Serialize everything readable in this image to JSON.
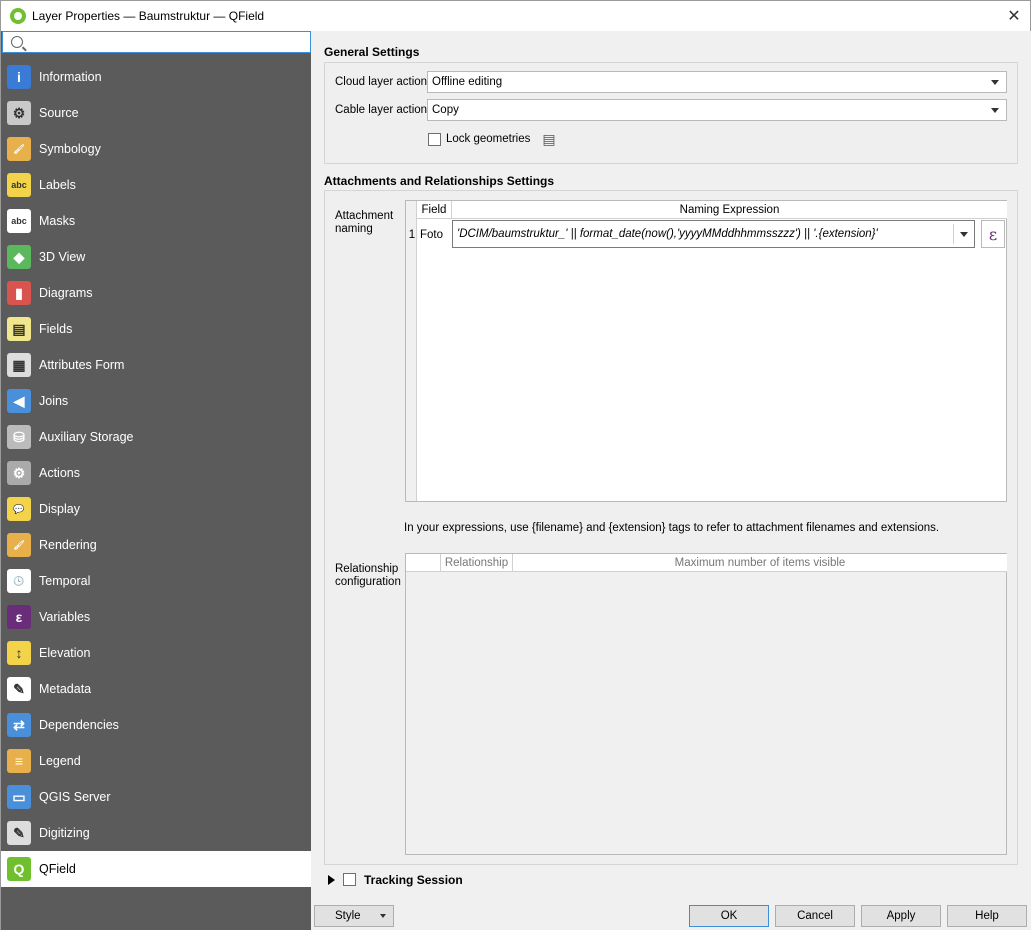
{
  "window": {
    "title": "Layer Properties — Baumstruktur — QField",
    "close_glyph": "✕"
  },
  "search": {
    "value": "",
    "placeholder": ""
  },
  "nav_items": [
    {
      "label": "Information",
      "icon": "info-icon",
      "color": "#3a7bd5",
      "glyph": "i"
    },
    {
      "label": "Source",
      "icon": "source-icon",
      "color": "#c9c9c9",
      "glyph": "⚙"
    },
    {
      "label": "Symbology",
      "icon": "symbology-icon",
      "color": "#e8b04a",
      "glyph": "🖌"
    },
    {
      "label": "Labels",
      "icon": "labels-icon",
      "color": "#f2d34a",
      "glyph": "abc"
    },
    {
      "label": "Masks",
      "icon": "masks-icon",
      "color": "#ffffff",
      "glyph": "abc"
    },
    {
      "label": "3D View",
      "icon": "3d-view-icon",
      "color": "#5cb85c",
      "glyph": "◆"
    },
    {
      "label": "Diagrams",
      "icon": "diagrams-icon",
      "color": "#d9534f",
      "glyph": "▮"
    },
    {
      "label": "Fields",
      "icon": "fields-icon",
      "color": "#f0e68c",
      "glyph": "▤"
    },
    {
      "label": "Attributes Form",
      "icon": "attributes-form-icon",
      "color": "#dddddd",
      "glyph": "▦"
    },
    {
      "label": "Joins",
      "icon": "joins-icon",
      "color": "#4a8fd9",
      "glyph": "◀"
    },
    {
      "label": "Auxiliary Storage",
      "icon": "auxiliary-storage-icon",
      "color": "#bbbbbb",
      "glyph": "⛁"
    },
    {
      "label": "Actions",
      "icon": "actions-icon",
      "color": "#aaaaaa",
      "glyph": "⚙"
    },
    {
      "label": "Display",
      "icon": "display-icon",
      "color": "#f2d34a",
      "glyph": "💬"
    },
    {
      "label": "Rendering",
      "icon": "rendering-icon",
      "color": "#e8b04a",
      "glyph": "🖌"
    },
    {
      "label": "Temporal",
      "icon": "temporal-icon",
      "color": "#ffffff",
      "glyph": "🕓"
    },
    {
      "label": "Variables",
      "icon": "variables-icon",
      "color": "#6a2d7a",
      "glyph": "ε"
    },
    {
      "label": "Elevation",
      "icon": "elevation-icon",
      "color": "#f2d34a",
      "glyph": "↕"
    },
    {
      "label": "Metadata",
      "icon": "metadata-icon",
      "color": "#ffffff",
      "glyph": "✎"
    },
    {
      "label": "Dependencies",
      "icon": "dependencies-icon",
      "color": "#4a8fd9",
      "glyph": "⇄"
    },
    {
      "label": "Legend",
      "icon": "legend-icon",
      "color": "#e8b04a",
      "glyph": "≡"
    },
    {
      "label": "QGIS Server",
      "icon": "qgis-server-icon",
      "color": "#4a8fd9",
      "glyph": "▭"
    },
    {
      "label": "Digitizing",
      "icon": "digitizing-icon",
      "color": "#dddddd",
      "glyph": "✎"
    },
    {
      "label": "QField",
      "icon": "qfield-icon",
      "color": "#6fbf2f",
      "glyph": "Q"
    }
  ],
  "active_nav": "QField",
  "general": {
    "title": "General Settings",
    "cloud_label": "Cloud layer action",
    "cloud_value": "Offline editing",
    "cable_label": "Cable layer action",
    "cable_value": "Copy",
    "lock_label": "Lock geometries",
    "lock_checked": false
  },
  "attachments": {
    "title": "Attachments and Relationships Settings",
    "naming_label_1": "Attachment",
    "naming_label_2": "naming",
    "col_field": "Field",
    "col_expr": "Naming Expression",
    "row_num": "1",
    "row_field": "Foto",
    "row_expr": "'DCIM/baumstruktur_' || format_date(now(),'yyyyMMddhhmmsszzz') || '.{extension}'",
    "epsilon": "ε",
    "hint": "In your expressions, use {filename} and {extension} tags to refer to attachment filenames and extensions.",
    "rel_label_1": "Relationship",
    "rel_label_2": "configuration",
    "rel_col_relationship": "Relationship",
    "rel_col_max": "Maximum number of items visible"
  },
  "tracking": {
    "label": "Tracking Session",
    "checked": false
  },
  "buttons": {
    "style": "Style",
    "ok": "OK",
    "cancel": "Cancel",
    "apply": "Apply",
    "help": "Help"
  }
}
